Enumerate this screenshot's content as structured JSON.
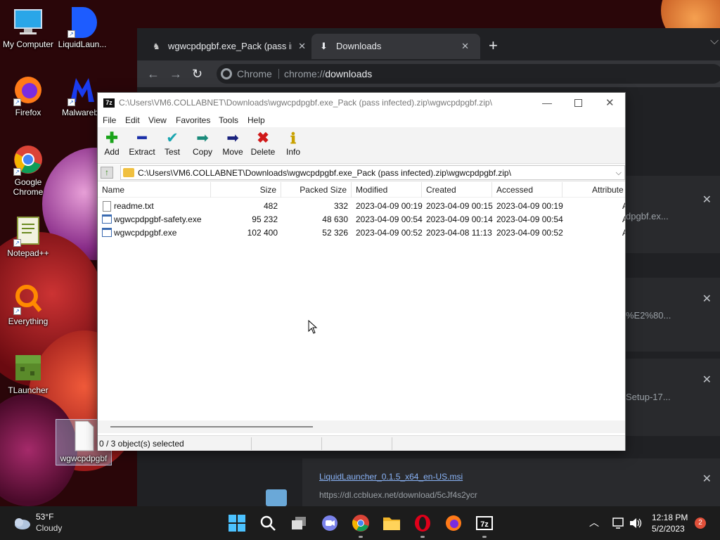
{
  "desktop": {
    "icons": [
      {
        "label": "My Computer",
        "icon": "computer-icon"
      },
      {
        "label": "LiquidLaun...",
        "icon": "liquidlauncher-icon"
      },
      {
        "label": "Firefox",
        "icon": "firefox-icon"
      },
      {
        "label": "Malwareby",
        "icon": "malwarebytes-icon"
      },
      {
        "label": "Google Chrome",
        "icon": "chrome-icon"
      },
      {
        "label": "Notepad++",
        "icon": "notepadpp-icon"
      },
      {
        "label": "Everything",
        "icon": "everything-icon"
      },
      {
        "label": "TLauncher",
        "icon": "tlauncher-icon"
      },
      {
        "label": "wgwcpdpgbf",
        "icon": "file-icon"
      }
    ]
  },
  "chrome": {
    "tabs": [
      {
        "title": "wgwcpdpgbf.exe_Pack (pass infec",
        "icon": "page-icon"
      },
      {
        "title": "Downloads",
        "icon": "download-icon"
      }
    ],
    "omnibox": {
      "site": "Chrome",
      "url_scheme": "chrome://",
      "url_path": "downloads"
    },
    "downloads": [
      {
        "partial": "dpgbf.ex..."
      },
      {
        "partial": "%E2%80..."
      },
      {
        "partial": "Setup-17..."
      },
      {
        "name": "LiquidLauncher_0.1.5_x64_en-US.msi",
        "url": "https://dl.ccbluex.net/download/5cJf4s2ycr"
      }
    ]
  },
  "zip": {
    "title": "C:\\Users\\VM6.COLLABNET\\Downloads\\wgwcpdpgbf.exe_Pack (pass infected).zip\\wgwcpdpgbf.zip\\",
    "app_icon_text": "7z",
    "menu": [
      "File",
      "Edit",
      "View",
      "Favorites",
      "Tools",
      "Help"
    ],
    "toolbar": [
      {
        "label": "Add",
        "icon": "add-icon",
        "color": "#1aa31a"
      },
      {
        "label": "Extract",
        "icon": "extract-icon",
        "color": "#1a2fa8"
      },
      {
        "label": "Test",
        "icon": "test-icon",
        "color": "#19a5b0"
      },
      {
        "label": "Copy",
        "icon": "copy-icon",
        "color": "#1a8a7a"
      },
      {
        "label": "Move",
        "icon": "move-icon",
        "color": "#1a237e"
      },
      {
        "label": "Delete",
        "icon": "delete-icon",
        "color": "#d01818"
      },
      {
        "label": "Info",
        "icon": "info-icon",
        "color": "#c9a100"
      }
    ],
    "path": "C:\\Users\\VM6.COLLABNET\\Downloads\\wgwcpdpgbf.exe_Pack (pass infected).zip\\wgwcpdpgbf.zip\\",
    "columns": [
      "Name",
      "Size",
      "Packed Size",
      "Modified",
      "Created",
      "Accessed",
      "Attribute"
    ],
    "files": [
      {
        "name": "readme.txt",
        "size": "482",
        "packed": "332",
        "modified": "2023-04-09 00:19",
        "created": "2023-04-09 00:15",
        "accessed": "2023-04-09 00:19",
        "attr": "A",
        "icon": "text-file-icon"
      },
      {
        "name": "wgwcpdpgbf-safety.exe",
        "size": "95 232",
        "packed": "48 630",
        "modified": "2023-04-09 00:54",
        "created": "2023-04-09 00:14",
        "accessed": "2023-04-09 00:54",
        "attr": "A",
        "icon": "exe-file-icon"
      },
      {
        "name": "wgwcpdpgbf.exe",
        "size": "102 400",
        "packed": "52 326",
        "modified": "2023-04-09 00:52",
        "created": "2023-04-08 11:13",
        "accessed": "2023-04-09 00:52",
        "attr": "A",
        "icon": "exe-file-icon"
      }
    ],
    "status": "0 / 3 object(s) selected"
  },
  "taskbar": {
    "weather": {
      "temp": "53°F",
      "condition": "Cloudy"
    },
    "time": "12:18 PM",
    "date": "5/2/2023",
    "notification_count": "2",
    "apps": [
      "start-icon",
      "search-icon",
      "task-view-icon",
      "chat-icon",
      "chrome-icon",
      "file-explorer-icon",
      "opera-icon",
      "firefox-icon",
      "7zip-icon"
    ]
  }
}
